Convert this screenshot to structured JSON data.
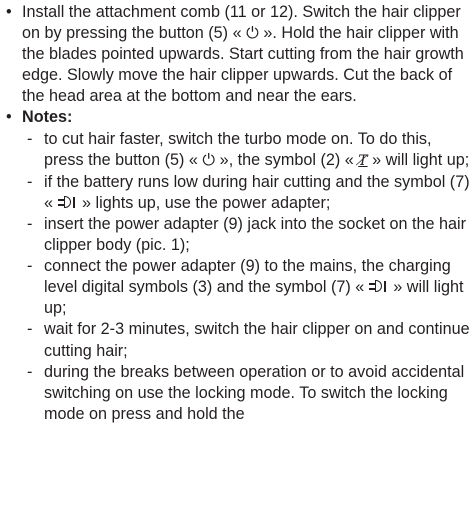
{
  "bullet_glyph": "•",
  "dash_glyph": "-",
  "icons": {
    "power": "⏻",
    "turbo": "T̸",
    "plug": "plug-icon"
  },
  "item1": {
    "text": "Install the attachment comb (11 or 12). Switch the hair clipper on by pressing the button (5) « ",
    "text_after": " ». Hold the hair clipper with the blades pointed upwards. Start cutting from the hair growth edge. Slowly move the hair clipper upwards. Cut the back of the head area at the bottom and near the ears."
  },
  "notes": {
    "title": "Notes:",
    "n1": {
      "a": "to cut hair faster, switch the turbo mode on. To do this, press the button (5) « ",
      "b": " », the symbol (2) « ",
      "c": " » will light up;"
    },
    "n2": {
      "a": "if the battery runs low during hair cutting and the symbol (7) « ",
      "b": " » lights up, use the power adapter;"
    },
    "n3": "insert the power adapter (9) jack into the socket on the hair clipper body (pic. 1);",
    "n4": {
      "a": "connect the power adapter (9) to the mains, the charging level digital symbols (3) and the symbol (7) « ",
      "b": " » will light up;"
    },
    "n5": "wait for 2-3 minutes, switch the hair clipper on and continue cutting hair;",
    "n6": "during the breaks between operation or to avoid accidental switching on use the locking mode. To switch the locking mode on press and hold the"
  }
}
